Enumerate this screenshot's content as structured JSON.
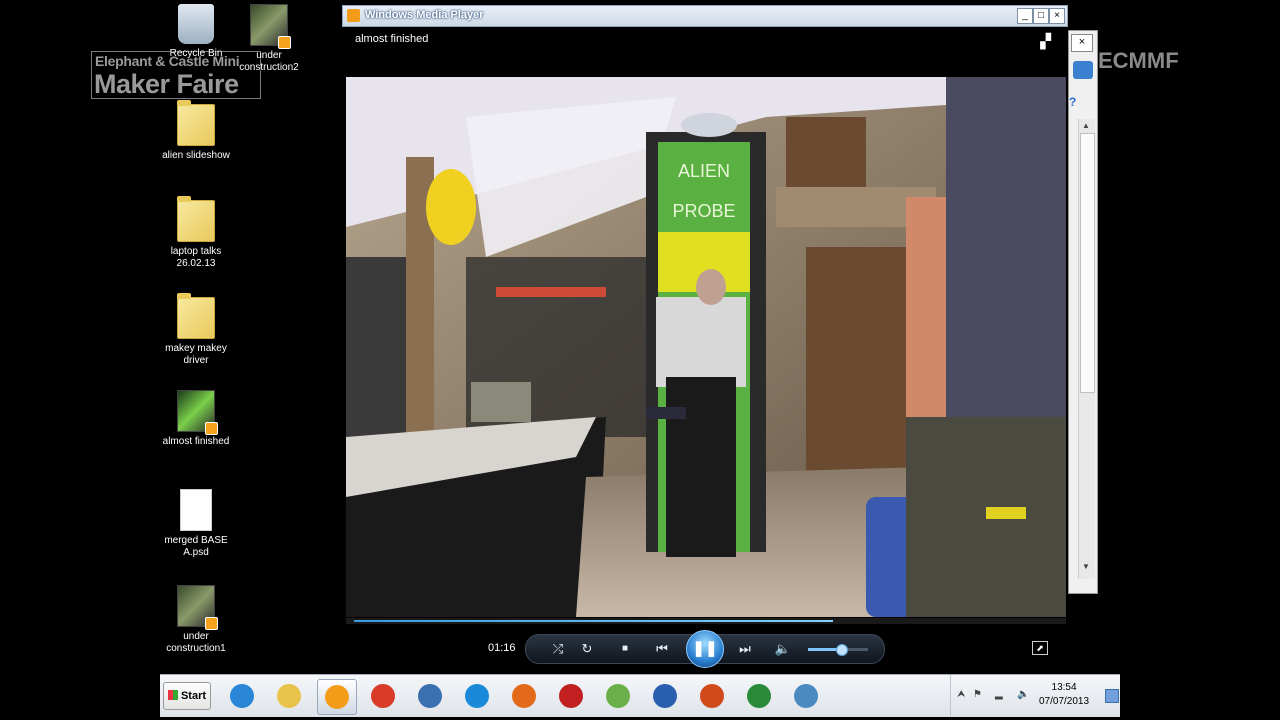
{
  "watermark": {
    "line1": "Elephant & Castle Mini",
    "line2": "Maker Faire",
    "right_tag": "ECMMF"
  },
  "desktop": {
    "icons": [
      {
        "label": "Recycle Bin",
        "icon": "recycle-bin-icon"
      },
      {
        "label": "under construction2",
        "icon": "video-file-icon"
      },
      {
        "label": "alien slideshow",
        "icon": "folder-icon"
      },
      {
        "label": "laptop talks 26.02.13",
        "icon": "folder-icon"
      },
      {
        "label": "makey makey driver",
        "icon": "folder-icon"
      },
      {
        "label": "almost finished",
        "icon": "video-file-icon"
      },
      {
        "label": "merged BASE A.psd",
        "icon": "document-icon"
      },
      {
        "label": "under construction1",
        "icon": "video-file-icon"
      }
    ]
  },
  "player": {
    "window_title": "Windows Media Player",
    "now_playing": "almost finished",
    "title_buttons": {
      "minimize": "_",
      "maximize": "□",
      "close": "×"
    },
    "elapsed": "01:16",
    "progress_fraction": 0.68,
    "volume_fraction": 0.55,
    "controls": {
      "shuffle": "⤮",
      "repeat": "↻",
      "stop": "■",
      "previous": "⏮",
      "play_pause": "❚❚",
      "next": "⏭",
      "mute": "🔈"
    },
    "video_sign_lines": [
      "ALIEN",
      "PROBE"
    ],
    "accent_color": "#3a9adf"
  },
  "taskbar": {
    "start_label": "Start",
    "pinned": [
      {
        "name": "internet-explorer-icon",
        "color": "#2a86d6"
      },
      {
        "name": "file-explorer-icon",
        "color": "#e8c24a"
      },
      {
        "name": "windows-media-player-icon",
        "color": "#f39c1a",
        "active": true
      },
      {
        "name": "chrome-icon",
        "color": "#d83b2a"
      },
      {
        "name": "thunderbird-icon",
        "color": "#3a6fb0"
      },
      {
        "name": "teamviewer-icon",
        "color": "#1a8ad8"
      },
      {
        "name": "firefox-icon",
        "color": "#e36a1a"
      },
      {
        "name": "app-icon-red",
        "color": "#c02020"
      },
      {
        "name": "picasa-icon",
        "color": "#6ab04a"
      },
      {
        "name": "word-icon",
        "color": "#2a5fb0"
      },
      {
        "name": "powerpoint-icon",
        "color": "#d04a1a"
      },
      {
        "name": "excel-icon",
        "color": "#2a8a3a"
      },
      {
        "name": "photo-viewer-icon",
        "color": "#4a8ac0"
      }
    ],
    "tray": {
      "time": "13:54",
      "date": "07/07/2013"
    }
  }
}
